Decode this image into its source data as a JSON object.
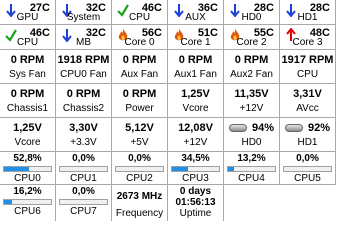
{
  "colors": {
    "blue_arrow": "#1e3fd6",
    "green_check": "#1aa31a",
    "flame": "#e05a10",
    "red_arrow": "#e00000",
    "bar": "#1f8fe8"
  },
  "temps": [
    [
      {
        "icon": "down-arrow-icon",
        "value": "27C",
        "label": "GPU"
      },
      {
        "icon": "down-arrow-icon",
        "value": "32C",
        "label": "System"
      },
      {
        "icon": "check-icon",
        "value": "46C",
        "label": "CPU"
      },
      {
        "icon": "down-arrow-icon",
        "value": "36C",
        "label": "AUX"
      },
      {
        "icon": "down-arrow-icon",
        "value": "28C",
        "label": "HD0"
      },
      {
        "icon": "down-arrow-icon",
        "value": "28C",
        "label": "HD1"
      }
    ],
    [
      {
        "icon": "check-icon",
        "value": "46C",
        "label": "CPU"
      },
      {
        "icon": "down-arrow-icon",
        "value": "32C",
        "label": "MB"
      },
      {
        "icon": "flame-icon",
        "value": "56C",
        "label": "Core 0"
      },
      {
        "icon": "flame-icon",
        "value": "51C",
        "label": "Core 1"
      },
      {
        "icon": "flame-icon",
        "value": "55C",
        "label": "Core 2"
      },
      {
        "icon": "up-arrow-icon",
        "value": "48C",
        "label": "Core 3"
      }
    ]
  ],
  "readings": [
    [
      {
        "value": "0 RPM",
        "label": "Sys Fan"
      },
      {
        "value": "1918 RPM",
        "label": "CPU0 Fan"
      },
      {
        "value": "0 RPM",
        "label": "Aux Fan"
      },
      {
        "value": "0 RPM",
        "label": "Aux1 Fan"
      },
      {
        "value": "0 RPM",
        "label": "Aux2 Fan"
      },
      {
        "value": "1917 RPM",
        "label": "CPU"
      }
    ],
    [
      {
        "value": "0 RPM",
        "label": "Chassis1"
      },
      {
        "value": "0 RPM",
        "label": "Chassis2"
      },
      {
        "value": "0 RPM",
        "label": "Power"
      },
      {
        "value": "1,25V",
        "label": "Vcore"
      },
      {
        "value": "11,35V",
        "label": "+12V"
      },
      {
        "value": "3,31V",
        "label": "AVcc"
      }
    ],
    [
      {
        "value": "1,25V",
        "label": "Vcore"
      },
      {
        "value": "3,30V",
        "label": "+3.3V"
      },
      {
        "value": "5,12V",
        "label": "+5V"
      },
      {
        "value": "12,08V",
        "label": "+12V"
      },
      {
        "value": "94%",
        "label": "HD0",
        "disk": true
      },
      {
        "value": "92%",
        "label": "HD1",
        "disk": true
      }
    ]
  ],
  "cpus": [
    {
      "value": "52,8%",
      "label": "CPU0",
      "fill": 0.528
    },
    {
      "value": "0,0%",
      "label": "CPU1",
      "fill": 0.0
    },
    {
      "value": "0,0%",
      "label": "CPU2",
      "fill": 0.0
    },
    {
      "value": "34,5%",
      "label": "CPU3",
      "fill": 0.345
    },
    {
      "value": "13,2%",
      "label": "CPU4",
      "fill": 0.132
    },
    {
      "value": "0,0%",
      "label": "CPU5",
      "fill": 0.0
    }
  ],
  "last_row": [
    {
      "type": "bar",
      "value": "16,2%",
      "label": "CPU6",
      "fill": 0.162
    },
    {
      "type": "bar",
      "value": "0,0%",
      "label": "CPU7",
      "fill": 0.0
    },
    {
      "type": "text",
      "value": "2673 MHz",
      "label": "Frequency"
    },
    {
      "type": "text",
      "value": "0 days\n01:56:13",
      "label": "Uptime"
    }
  ]
}
